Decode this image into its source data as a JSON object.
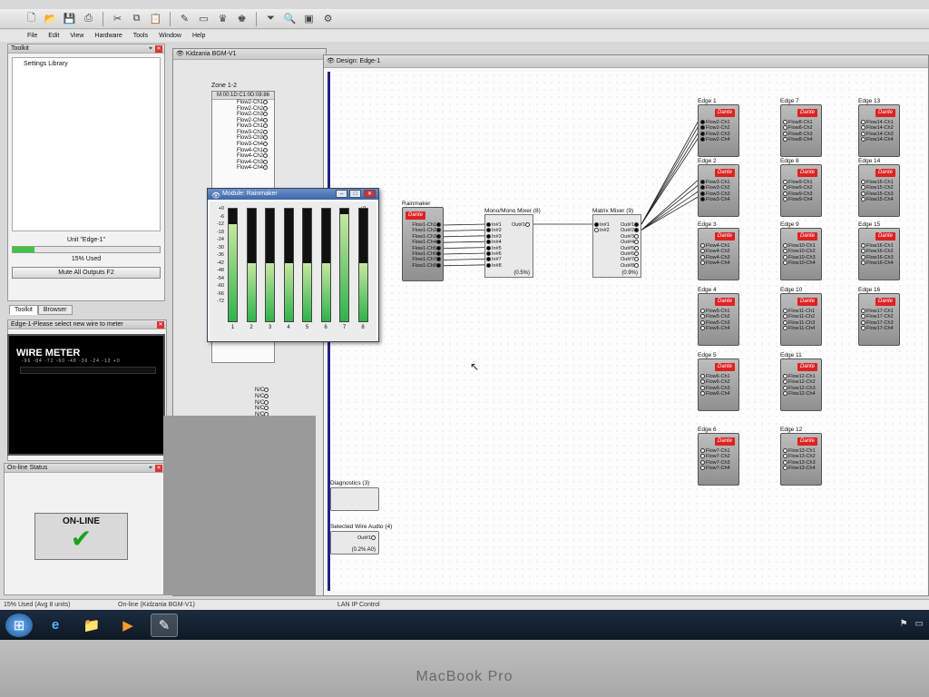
{
  "menu": [
    "File",
    "Edit",
    "View",
    "Hardware",
    "Tools",
    "Window",
    "Help"
  ],
  "toolkit_panel": {
    "title": "Toolkit",
    "settings_library": "Settings Library",
    "unit_label": "Unit \"Edge-1\"",
    "usage_percent": 15,
    "used_label": "15% Used",
    "mute_button": "Mute All Outputs  F2"
  },
  "tabs": [
    {
      "label": "Toolkit",
      "active": true
    },
    {
      "label": "Browser",
      "active": false
    }
  ],
  "wire_meter_panel": {
    "title": "Edge-1-Please select new wire to meter",
    "heading": "WIRE METER",
    "scale": "-96  -84  -72  -60  -48  -36  -24  -12  +0"
  },
  "online_panel": {
    "title": "On-line Status",
    "status": "ON-LINE"
  },
  "kidzania_window": {
    "title": "Kidzania BGM-V1",
    "zone_label": "Zone 1-2",
    "zone_mac": "M:00:1D:C1:0D:08:86",
    "flows": [
      "Flow2-Ch1",
      "Flow2-Ch2",
      "Flow2-Ch3",
      "Flow2-Ch4",
      "Flow3-Ch1",
      "Flow3-Ch2",
      "Flow3-Ch3",
      "Flow3-Ch4",
      "Flow4-Ch1",
      "Flow4-Ch2",
      "Flow4-Ch3",
      "Flow4-Ch4"
    ],
    "dante": "Dante",
    "nc": [
      "N/C",
      "N/C",
      "N/C",
      "N/C",
      "N/C",
      "N/C",
      "N/C",
      "N/C",
      "N/C",
      "N/C"
    ]
  },
  "rainmaker_window": {
    "title": "Module: Rainmaker",
    "scale": [
      "+0",
      "-6",
      "-12",
      "-18",
      "-24",
      "-30",
      "-36",
      "-42",
      "-48",
      "-54",
      "-60",
      "-66",
      "-72"
    ],
    "channels": [
      {
        "label": "1",
        "level": 0.86
      },
      {
        "label": "2",
        "level": 0.52
      },
      {
        "label": "3",
        "level": 0.52
      },
      {
        "label": "4",
        "level": 0.52
      },
      {
        "label": "5",
        "level": 0.52
      },
      {
        "label": "6",
        "level": 0.52
      },
      {
        "label": "7",
        "level": 0.95
      },
      {
        "label": "8",
        "level": 0.52
      }
    ]
  },
  "design_window": {
    "title": "Design: Edge-1",
    "rainmaker": {
      "label": "Rainmaker",
      "dante": "Dante",
      "channels": [
        "Flow1-Ch1",
        "Flow1-Ch2",
        "Flow1-Ch3",
        "Flow1-Ch4",
        "Flow1-Ch5",
        "Flow1-Ch6",
        "Flow1-Ch7",
        "Flow1-Ch8"
      ]
    },
    "mono_mixer": {
      "label": "Mono/Mono Mixer (8)",
      "inputs": [
        "In#1",
        "In#2",
        "In#3",
        "In#4",
        "In#5",
        "In#6",
        "In#7",
        "In#8"
      ],
      "output": "Out#1",
      "usage": "(0.5%)"
    },
    "matrix_mixer": {
      "label": "Matrix Mixer (9)",
      "inputs": [
        "In#1",
        "In#2"
      ],
      "outputs": [
        "Out#1",
        "Out#2",
        "Out#3",
        "Out#4",
        "Out#5",
        "Out#6",
        "Out#7",
        "Out#8"
      ],
      "usage": "(0.9%)"
    },
    "diagnostics": {
      "label": "Diagnostics (3)"
    },
    "selected_wire": {
      "label": "Selected Wire Audio (4)",
      "out": "Out#1",
      "usage": "(0.2% A0)"
    },
    "edges": [
      {
        "label": "Edge 1",
        "flows": [
          "Flow2-Ch1",
          "Flow2-Ch2",
          "Flow2-Ch3",
          "Flow2-Ch4"
        ]
      },
      {
        "label": "Edge 2",
        "flows": [
          "Flow3-Ch1",
          "Flow3-Ch2",
          "Flow3-Ch3",
          "Flow3-Ch4"
        ]
      },
      {
        "label": "Edge 3",
        "flows": [
          "Flow4-Ch1",
          "Flow4-Ch2",
          "Flow4-Ch3",
          "Flow4-Ch4"
        ]
      },
      {
        "label": "Edge 4",
        "flows": [
          "Flow5-Ch1",
          "Flow5-Ch2",
          "Flow5-Ch3",
          "Flow5-Ch4"
        ]
      },
      {
        "label": "Edge 5",
        "flows": [
          "Flow6-Ch1",
          "Flow6-Ch2",
          "Flow6-Ch3",
          "Flow6-Ch4"
        ]
      },
      {
        "label": "Edge 6",
        "flows": [
          "Flow7-Ch1",
          "Flow7-Ch2",
          "Flow7-Ch3",
          "Flow7-Ch4"
        ]
      },
      {
        "label": "Edge 7",
        "flows": [
          "Flow8-Ch1",
          "Flow8-Ch2",
          "Flow8-Ch3",
          "Flow8-Ch4"
        ]
      },
      {
        "label": "Edge 8",
        "flows": [
          "Flow9-Ch1",
          "Flow9-Ch2",
          "Flow9-Ch3",
          "Flow9-Ch4"
        ]
      },
      {
        "label": "Edge 9",
        "flows": [
          "Flow10-Ch1",
          "Flow10-Ch2",
          "Flow10-Ch3",
          "Flow10-Ch4"
        ]
      },
      {
        "label": "Edge 10",
        "flows": [
          "Flow11-Ch1",
          "Flow11-Ch2",
          "Flow11-Ch3",
          "Flow11-Ch4"
        ]
      },
      {
        "label": "Edge 11",
        "flows": [
          "Flow12-Ch1",
          "Flow12-Ch2",
          "Flow12-Ch3",
          "Flow12-Ch4"
        ]
      },
      {
        "label": "Edge 12",
        "flows": [
          "Flow13-Ch1",
          "Flow13-Ch2",
          "Flow13-Ch3",
          "Flow13-Ch4"
        ]
      },
      {
        "label": "Edge 13",
        "flows": [
          "Flow14-Ch1",
          "Flow14-Ch2",
          "Flow14-Ch3",
          "Flow14-Ch4"
        ]
      },
      {
        "label": "Edge 14",
        "flows": [
          "Flow15-Ch1",
          "Flow15-Ch2",
          "Flow15-Ch3",
          "Flow15-Ch4"
        ]
      },
      {
        "label": "Edge 15",
        "flows": [
          "Flow16-Ch1",
          "Flow16-Ch2",
          "Flow16-Ch3",
          "Flow16-Ch4"
        ]
      },
      {
        "label": "Edge 16",
        "flows": [
          "Flow17-Ch1",
          "Flow17-Ch2",
          "Flow17-Ch3",
          "Flow17-Ch4"
        ]
      }
    ]
  },
  "statusbar": {
    "usage": "15% Used (Avg 8 units)",
    "online": "On-line (Kidzania BGM-V1)",
    "network": "LAN IP Control"
  },
  "bezel": "MacBook Pro"
}
